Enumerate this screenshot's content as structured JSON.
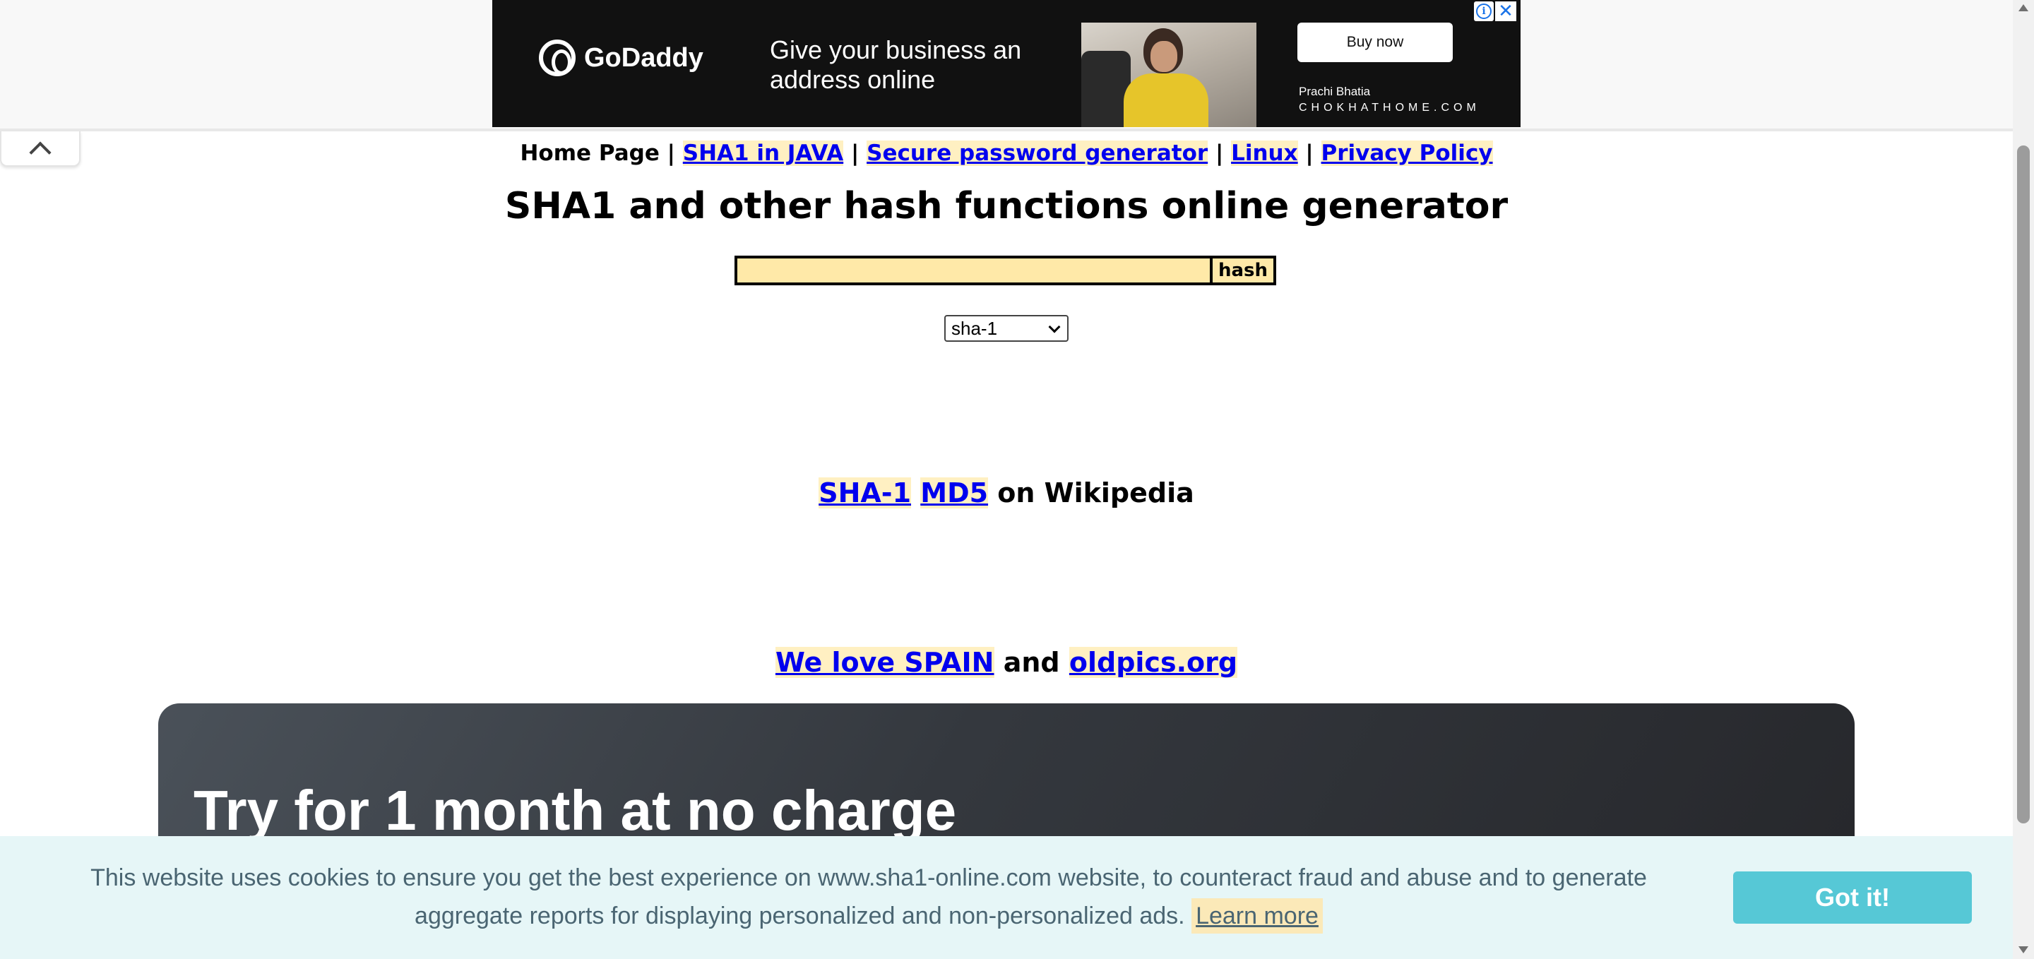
{
  "ad": {
    "brand": "GoDaddy",
    "tagline": "Give your business an address online",
    "button": "Buy now",
    "credit": "Prachi Bhatia",
    "site": "CHOKHATHOME.COM",
    "info_icon": "i",
    "close_icon": "✕"
  },
  "nav": {
    "home": "Home Page",
    "separator": "|",
    "links": [
      "SHA1 in JAVA",
      "Secure password generator",
      "Linux",
      "Privacy Policy"
    ]
  },
  "page_title": "SHA1 and other hash functions online generator",
  "form": {
    "input_value": "",
    "button": "hash",
    "algorithm": "sha-1"
  },
  "wiki": {
    "link1": "SHA-1",
    "link2": "MD5",
    "suffix": "on Wikipedia"
  },
  "spain": {
    "link1": "We love SPAIN",
    "middle": "and",
    "link2": "oldpics.org"
  },
  "promo": {
    "title": "Try for 1 month at no charge"
  },
  "cookie": {
    "text": "This website uses cookies to ensure you get the best experience on www.sha1-online.com website, to counteract fraud and abuse and to generate aggregate reports for displaying personalized and non-personalized ads.",
    "learn_more": "Learn more",
    "button": "Got it!"
  },
  "colors": {
    "link": "#0000ee",
    "link_highlight": "#fff0c2",
    "input_bg": "#ffe9a8",
    "cookie_bg": "#e6f6f7",
    "cookie_button": "#56c8d6"
  }
}
